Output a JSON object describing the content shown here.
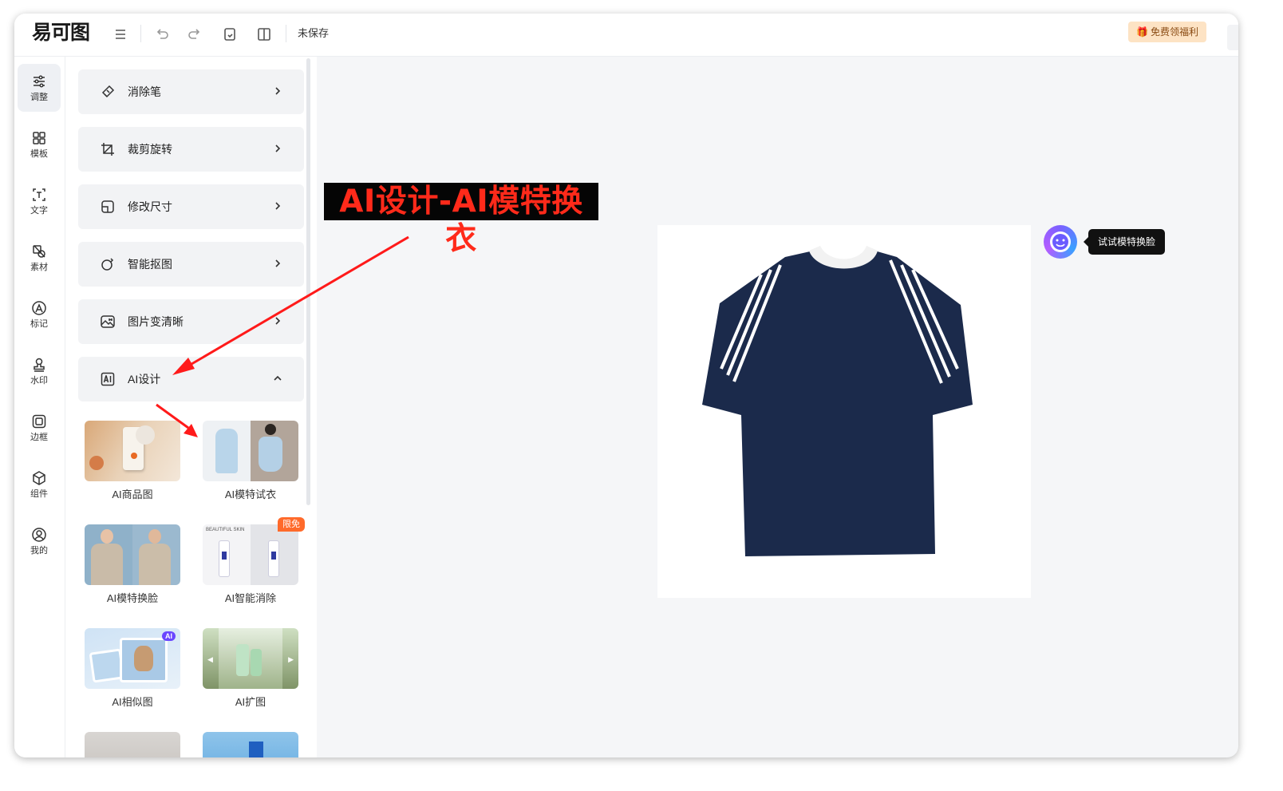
{
  "app": {
    "logo": "易可图",
    "save_status": "未保存"
  },
  "toolbar": {
    "gift_label": "免费领福利",
    "icons": [
      "menu-icon",
      "undo-icon",
      "redo-icon",
      "history-icon",
      "compare-icon"
    ]
  },
  "rail": {
    "items": [
      {
        "label": "调整",
        "icon": "sliders-icon",
        "active": true
      },
      {
        "label": "模板",
        "icon": "grid-icon"
      },
      {
        "label": "文字",
        "icon": "text-icon"
      },
      {
        "label": "素材",
        "icon": "shapes-icon"
      },
      {
        "label": "标记",
        "icon": "marker-icon"
      },
      {
        "label": "水印",
        "icon": "stamp-icon"
      },
      {
        "label": "边框",
        "icon": "frame-icon"
      },
      {
        "label": "组件",
        "icon": "cube-icon"
      },
      {
        "label": "我的",
        "icon": "user-icon"
      }
    ]
  },
  "panel": {
    "tools": [
      {
        "label": "消除笔",
        "icon": "eraser-icon"
      },
      {
        "label": "裁剪旋转",
        "icon": "crop-icon"
      },
      {
        "label": "修改尺寸",
        "icon": "resize-icon"
      },
      {
        "label": "智能抠图",
        "icon": "cutout-icon"
      },
      {
        "label": "图片变清晰",
        "icon": "hd-icon"
      },
      {
        "label": "AI设计",
        "icon": "ai-icon",
        "expanded": true
      }
    ],
    "ai_tiles": [
      {
        "label": "AI商品图"
      },
      {
        "label": "AI模特试衣"
      },
      {
        "label": "AI模特换脸"
      },
      {
        "label": "AI智能消除",
        "badge": "限免"
      },
      {
        "label": "AI相似图"
      },
      {
        "label": "AI扩图"
      }
    ]
  },
  "canvas": {
    "try_face_tooltip": "试试模特换脸",
    "shirt_color": "#1b2a4b"
  },
  "annotation": {
    "text": "AI设计-AI模特换衣",
    "color": "#ff2a1a"
  }
}
